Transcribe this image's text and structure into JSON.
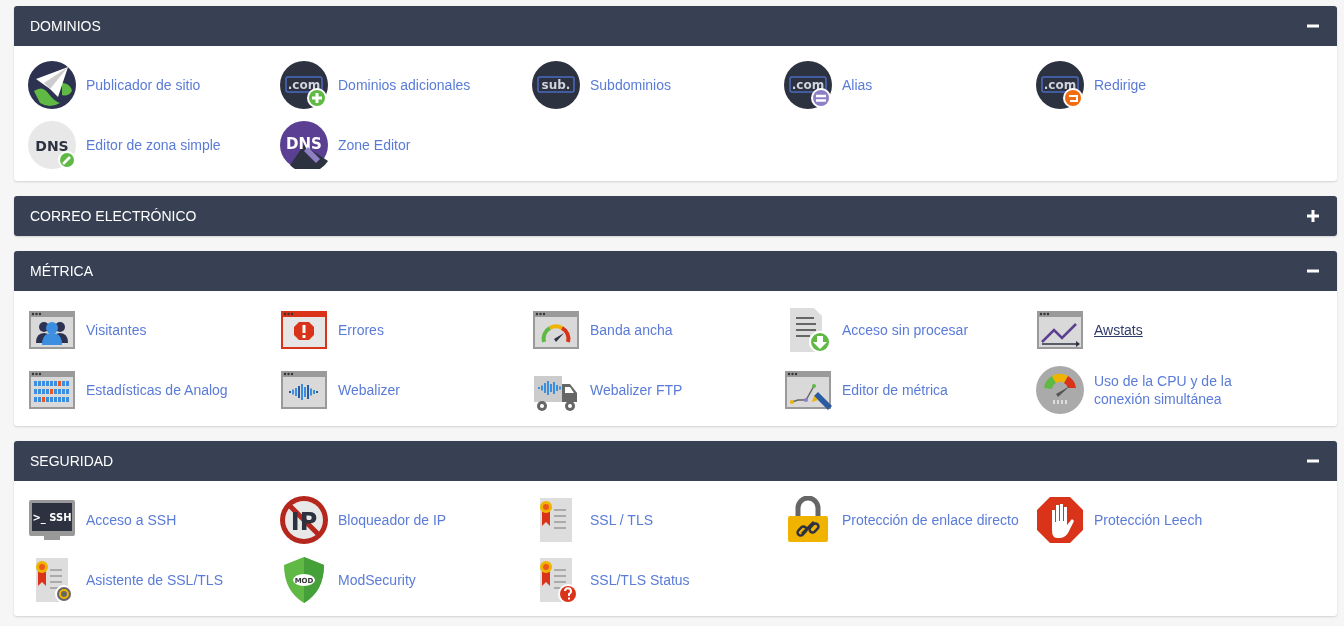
{
  "panels": [
    {
      "title": "DOMINIOS",
      "expanded": true,
      "items": [
        {
          "label": "Publicador de sitio",
          "kind": "globe-plane",
          "hovered": false
        },
        {
          "label": "Dominios adicionales",
          "kind": "com-plus",
          "icon_text": ".com",
          "hovered": false
        },
        {
          "label": "Subdominios",
          "kind": "sub",
          "icon_text": "sub.",
          "hovered": false
        },
        {
          "label": "Alias",
          "kind": "com-equals",
          "icon_text": ".com",
          "hovered": false
        },
        {
          "label": "Redirige",
          "kind": "com-redirect",
          "icon_text": ".com",
          "hovered": false
        },
        {
          "label": "Editor de zona simple",
          "kind": "dns-edit",
          "icon_text": "DNS",
          "hovered": false
        },
        {
          "label": "Zone Editor",
          "kind": "dns-purple",
          "icon_text": "DNS",
          "hovered": false
        }
      ]
    },
    {
      "title": "CORREO ELECTRÓNICO",
      "expanded": false
    },
    {
      "title": "MÉTRICA",
      "expanded": true,
      "items": [
        {
          "label": "Visitantes",
          "kind": "visitors",
          "hovered": false
        },
        {
          "label": "Errores",
          "kind": "errors",
          "hovered": false
        },
        {
          "label": "Banda ancha",
          "kind": "bandwidth",
          "hovered": false
        },
        {
          "label": "Acceso sin procesar",
          "kind": "raw-access",
          "hovered": false
        },
        {
          "label": "Awstats",
          "kind": "awstats",
          "hovered": true
        },
        {
          "label": "Estadísticas de Analog",
          "kind": "analog",
          "hovered": false
        },
        {
          "label": "Webalizer",
          "kind": "webalizer",
          "hovered": false
        },
        {
          "label": "Webalizer FTP",
          "kind": "webalizer-ftp",
          "hovered": false
        },
        {
          "label": "Editor de métrica",
          "kind": "metric-editor",
          "hovered": false
        },
        {
          "label": "Uso de la CPU y de la conexión simultánea",
          "kind": "cpu-gauge",
          "hovered": false
        }
      ]
    },
    {
      "title": "SEGURIDAD",
      "expanded": true,
      "items": [
        {
          "label": "Acceso a SSH",
          "kind": "ssh",
          "icon_text": ">_ SSH",
          "hovered": false
        },
        {
          "label": "Bloqueador de IP",
          "kind": "ip-block",
          "icon_text": "IP",
          "hovered": false
        },
        {
          "label": "SSL / TLS",
          "kind": "ssl-cert",
          "hovered": false
        },
        {
          "label": "Protección de enlace directo",
          "kind": "lock-link",
          "hovered": false
        },
        {
          "label": "Protección Leech",
          "kind": "stop-hand",
          "hovered": false
        },
        {
          "label": "Asistente de SSL/TLS",
          "kind": "ssl-wizard",
          "hovered": false
        },
        {
          "label": "ModSecurity",
          "kind": "modsecurity",
          "icon_text": "MOD",
          "hovered": false
        },
        {
          "label": "SSL/TLS Status",
          "kind": "ssl-status",
          "hovered": false
        }
      ]
    }
  ]
}
